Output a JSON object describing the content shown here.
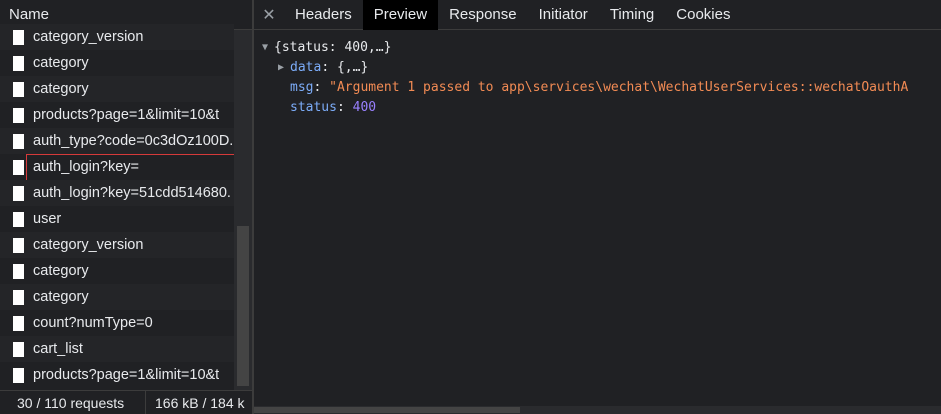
{
  "left": {
    "header": "Name",
    "rows": [
      "category_version",
      "category",
      "category",
      "products?page=1&limit=10&t",
      "auth_type?code=0c3dOz100D.",
      "auth_login?key=",
      "auth_login?key=51cdd514680.",
      "user",
      "category_version",
      "category",
      "category",
      "count?numType=0",
      "cart_list",
      "products?page=1&limit=10&t"
    ],
    "status": {
      "requests": "30 / 110 requests",
      "size": "166 kB / 184 k"
    }
  },
  "right": {
    "tabs": [
      "Headers",
      "Preview",
      "Response",
      "Initiator",
      "Timing",
      "Cookies"
    ],
    "active_tab": "Preview",
    "preview": {
      "root_summary": "{status: 400,…}",
      "data_key": "data",
      "data_value": "{,…}",
      "msg_key": "msg",
      "msg_value": "\"Argument 1 passed to app\\services\\wechat\\WechatUserServices::wechatOauthA",
      "status_key": "status",
      "status_value": "400"
    }
  },
  "colors": {
    "background": "#202124",
    "selected_outline": "#d63a3a",
    "key": "#7cacf8",
    "string": "#f28b54",
    "number": "#9980ff"
  }
}
